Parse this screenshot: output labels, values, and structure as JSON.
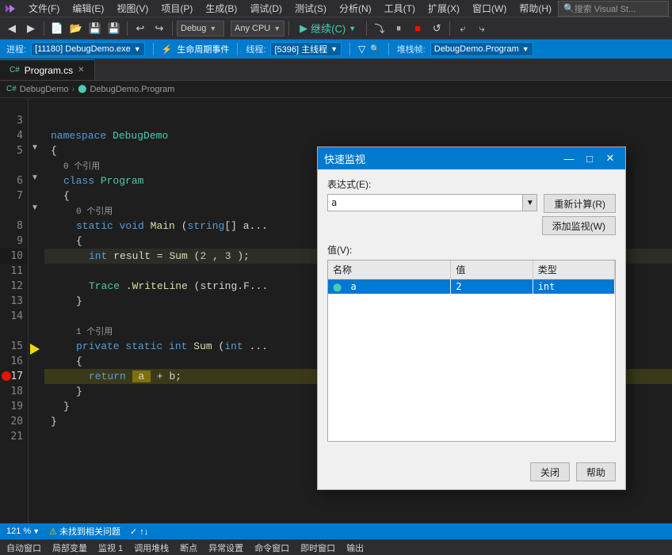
{
  "menubar": {
    "logo": "VS",
    "items": [
      "文件(F)",
      "编辑(E)",
      "视图(V)",
      "项目(P)",
      "生成(B)",
      "调试(D)",
      "测试(S)",
      "分析(N)",
      "工具(T)",
      "扩展(X)",
      "窗口(W)",
      "帮助(H)"
    ],
    "search_placeholder": "搜索 Visual St..."
  },
  "toolbar": {
    "config": "Debug",
    "platform": "Any CPU",
    "continue_label": "继续(C)",
    "breakpoint_icon": "⬤"
  },
  "debug_bar": {
    "process_label": "进程:",
    "process_value": "[11180] DebugDemo.exe",
    "lifecycle_label": "生命周期事件",
    "thread_label": "线程:",
    "thread_value": "[5396] 主线程",
    "stack_label": "堆栈帧:",
    "stack_value": "DebugDemo.Program"
  },
  "tabs": [
    {
      "label": "Program.cs",
      "active": true,
      "modified": false
    },
    {
      "label": "",
      "active": false
    }
  ],
  "breadcrumb": {
    "namespace": "DebugDemo",
    "class": "DebugDemo.Program"
  },
  "code": {
    "lines": [
      {
        "num": "3",
        "indent": 0,
        "content": ""
      },
      {
        "num": "4",
        "indent": 1,
        "content": "namespace DebugDemo"
      },
      {
        "num": "5",
        "indent": 1,
        "content": "{"
      },
      {
        "num": "",
        "indent": 2,
        "content": "0 个引用",
        "isref": true
      },
      {
        "num": "6",
        "indent": 2,
        "content": "class Program"
      },
      {
        "num": "7",
        "indent": 2,
        "content": "{"
      },
      {
        "num": "",
        "indent": 3,
        "content": "0 个引用",
        "isref": true
      },
      {
        "num": "8",
        "indent": 3,
        "content": "static void Main(string[] a..."
      },
      {
        "num": "9",
        "indent": 3,
        "content": "{"
      },
      {
        "num": "10",
        "indent": 4,
        "content": "int result = Sum(2, 3);",
        "highlighted": true
      },
      {
        "num": "11",
        "indent": 4,
        "content": ""
      },
      {
        "num": "12",
        "indent": 4,
        "content": "Trace.WriteLine(string.F..."
      },
      {
        "num": "13",
        "indent": 3,
        "content": "}"
      },
      {
        "num": "14",
        "indent": 3,
        "content": ""
      },
      {
        "num": "",
        "indent": 3,
        "content": "1 个引用",
        "isref": true
      },
      {
        "num": "15",
        "indent": 3,
        "content": "private static int Sum(int ..."
      },
      {
        "num": "16",
        "indent": 3,
        "content": "{"
      },
      {
        "num": "17",
        "indent": 4,
        "content": "return a + b;",
        "current": true,
        "breakpoint": true,
        "arrow": true
      },
      {
        "num": "18",
        "indent": 3,
        "content": "}"
      },
      {
        "num": "19",
        "indent": 2,
        "content": "}"
      },
      {
        "num": "20",
        "indent": 1,
        "content": "}"
      },
      {
        "num": "21",
        "indent": 0,
        "content": ""
      }
    ]
  },
  "dialog": {
    "title": "快速监视",
    "expression_label": "表达式(E):",
    "expression_value": "a",
    "recalc_button": "重新计算(R)",
    "add_watch_button": "添加监视(W)",
    "value_label": "值(V):",
    "table": {
      "headers": [
        "名称",
        "值",
        "类型"
      ],
      "rows": [
        {
          "name": "a",
          "value": "2",
          "type": "int",
          "selected": true
        }
      ]
    },
    "close_button": "关闭",
    "help_button": "帮助"
  },
  "statusbar": {
    "zoom": "121 %",
    "warning_icon": "⚠",
    "warning_text": "未找到相关问题",
    "check_icon": "✓",
    "arrow_icon": "↑↓"
  },
  "bottombar": {
    "items": [
      "自动窗口",
      "局部变量",
      "监视 1",
      "调用堆栈",
      "断点",
      "异常设置",
      "命令窗口",
      "即时窗口",
      "输出"
    ]
  }
}
